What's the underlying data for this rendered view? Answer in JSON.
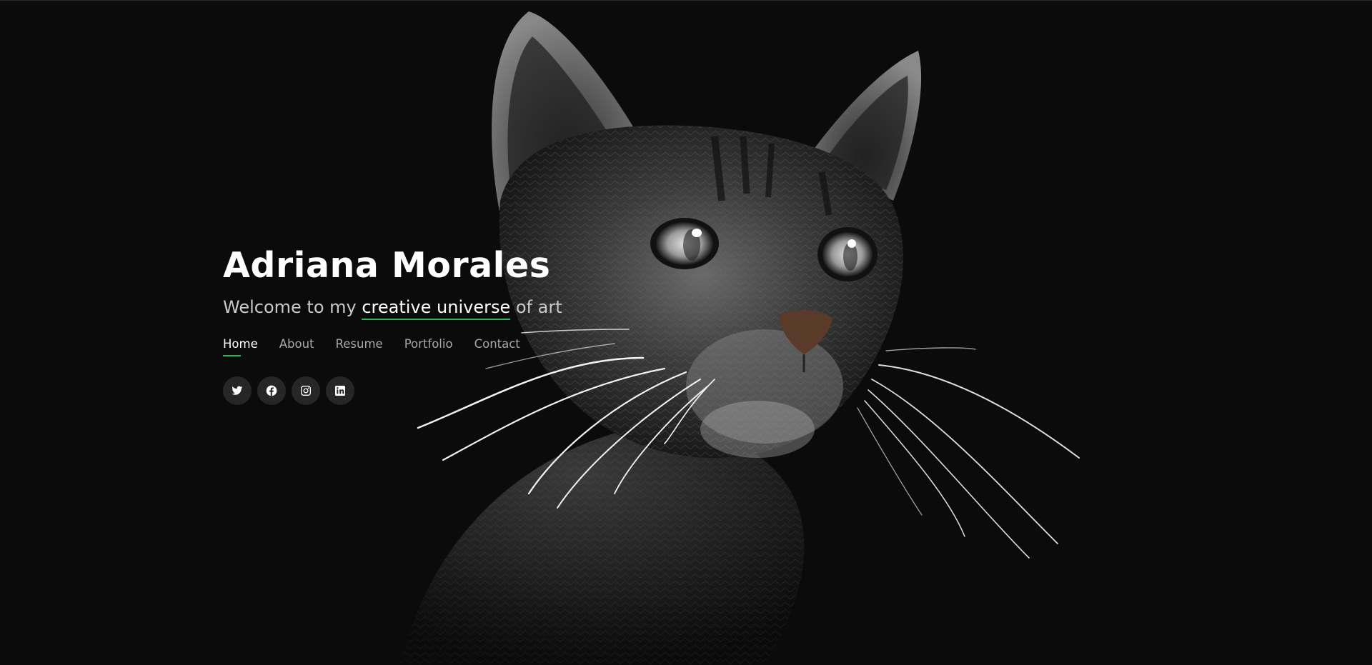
{
  "hero": {
    "name": "Adriana Morales",
    "tagline_before": "Welcome to my ",
    "tagline_highlight": "creative universe",
    "tagline_after": " of art"
  },
  "nav": {
    "items": [
      {
        "label": "Home",
        "active": true
      },
      {
        "label": "About",
        "active": false
      },
      {
        "label": "Resume",
        "active": false
      },
      {
        "label": "Portfolio",
        "active": false
      },
      {
        "label": "Contact",
        "active": false
      }
    ]
  },
  "socials": [
    {
      "icon": "twitter-icon"
    },
    {
      "icon": "facebook-icon"
    },
    {
      "icon": "instagram-icon"
    },
    {
      "icon": "linkedin-icon"
    }
  ],
  "colors": {
    "background": "#0b0b0b",
    "accent": "#2fb45a",
    "text": "#ffffff",
    "muted_text": "#a8a8a8",
    "social_bg": "#262626"
  }
}
